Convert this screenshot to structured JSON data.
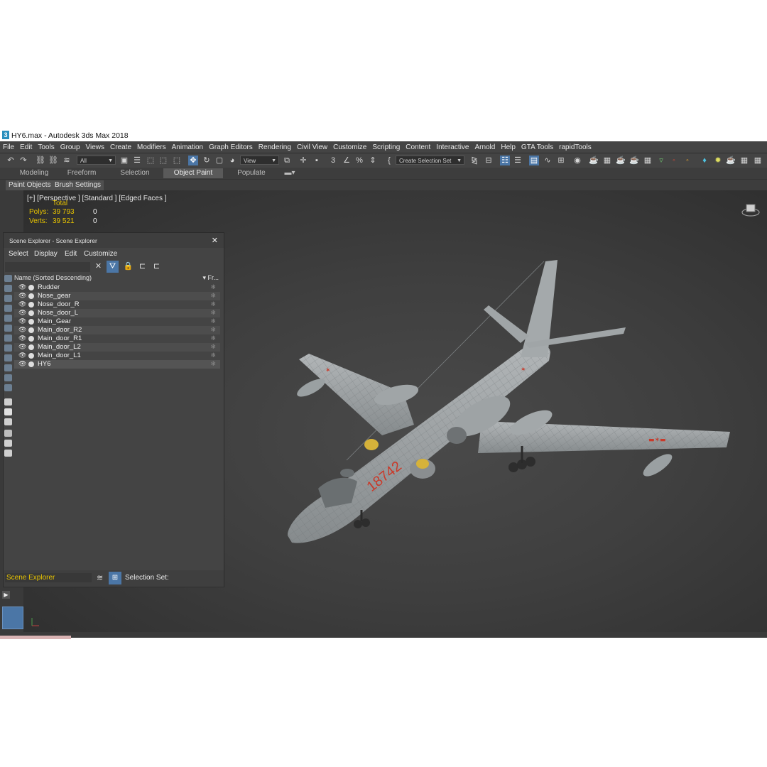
{
  "window": {
    "title": "HY6.max - Autodesk 3ds Max 2018",
    "app_icon_glyph": "3"
  },
  "menu": [
    "File",
    "Edit",
    "Tools",
    "Group",
    "Views",
    "Create",
    "Modifiers",
    "Animation",
    "Graph Editors",
    "Rendering",
    "Civil View",
    "Customize",
    "Scripting",
    "Content",
    "Interactive",
    "Arnold",
    "Help",
    "GTA Tools",
    "rapidTools"
  ],
  "toolbar": {
    "selection_filter": "All",
    "ref_coord": "View",
    "selection_set_placeholder": "Create Selection Set"
  },
  "ribbon": {
    "tabs": [
      "Modeling",
      "Freeform",
      "Selection",
      "Object Paint",
      "Populate"
    ],
    "active_tab": "Object Paint",
    "panel_buttons": [
      "Paint Objects",
      "Brush Settings"
    ]
  },
  "viewport": {
    "label": "[+] [Perspective ] [Standard ] [Edged Faces ]",
    "stats": {
      "total_label": "Total",
      "polys_label": "Polys:",
      "polys_total": "39 793",
      "polys_sel": "0",
      "verts_label": "Verts:",
      "verts_total": "39 521",
      "verts_sel": "0"
    },
    "aircraft_marking": "18742",
    "colors": {
      "background": "#3a3a3a",
      "model": "#9ea3a5",
      "accent_red": "#c93a2a"
    }
  },
  "scene_explorer": {
    "title": "Scene Explorer - Scene Explorer",
    "menu": [
      "Select",
      "Display",
      "Edit",
      "Customize"
    ],
    "column_name": "Name (Sorted Descending)",
    "column_frozen": "▾ Fr...",
    "rows": [
      "Rudder",
      "Nose_gear",
      "Nose_door_R",
      "Nose_door_L",
      "Main_Gear",
      "Main_door_R2",
      "Main_door_R1",
      "Main_door_L2",
      "Main_door_L1",
      "HY6"
    ],
    "bottom_label": "Scene Explorer",
    "selection_set_label": "Selection Set:"
  }
}
